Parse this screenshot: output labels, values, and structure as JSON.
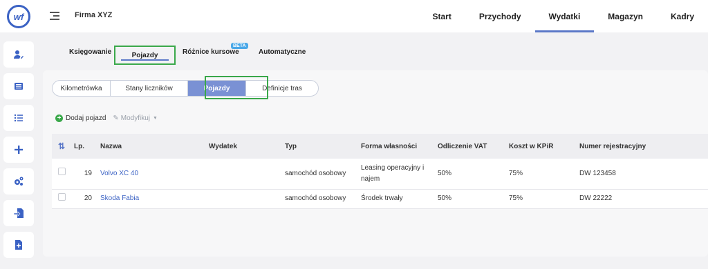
{
  "app": {
    "logo_text": "wf",
    "company": "Firma XYZ"
  },
  "topnav": [
    {
      "label": "Start",
      "active": false
    },
    {
      "label": "Przychody",
      "active": false
    },
    {
      "label": "Wydatki",
      "active": true
    },
    {
      "label": "Magazyn",
      "active": false
    },
    {
      "label": "Kadry",
      "active": false
    }
  ],
  "sidebar": [
    "user-edit-icon",
    "document-list-icon",
    "bullet-list-icon",
    "plus-icon",
    "settings-gears-icon",
    "import-icon",
    "add-document-icon"
  ],
  "subtabs": {
    "ksiegowanie": "Księgowanie",
    "pojazdy": "Pojazdy",
    "roznice": "Różnice kursowe",
    "beta": "BETA",
    "automatyczne": "Automatyczne"
  },
  "pills": {
    "kilometrowka": "Kilometrówka",
    "stany": "Stany liczników",
    "pojazdy": "Pojazdy",
    "definicje": "Definicje tras"
  },
  "toolbar": {
    "add": "Dodaj pojazd",
    "modify": "Modyfikuj"
  },
  "table": {
    "headers": {
      "lp": "Lp.",
      "nazwa": "Nazwa",
      "wydatek": "Wydatek",
      "typ": "Typ",
      "forma": "Forma własności",
      "vat": "Odliczenie VAT",
      "kpir": "Koszt w KPiR",
      "nr": "Numer rejestracyjny"
    },
    "rows": [
      {
        "lp": "19",
        "nazwa": "Volvo XC 40",
        "wydatek": "",
        "typ": "samochód osobowy",
        "forma": "Leasing operacyjny i najem",
        "vat": "50%",
        "kpir": "75%",
        "nr": "DW 123458"
      },
      {
        "lp": "20",
        "nazwa": "Skoda Fabia",
        "wydatek": "",
        "typ": "samochód osobowy",
        "forma": "Środek trwały",
        "vat": "50%",
        "kpir": "75%",
        "nr": "DW 22222"
      }
    ]
  },
  "colors": {
    "accent": "#3b62c4",
    "active_pill": "#7a91d4",
    "highlight": "#3aa84a"
  }
}
